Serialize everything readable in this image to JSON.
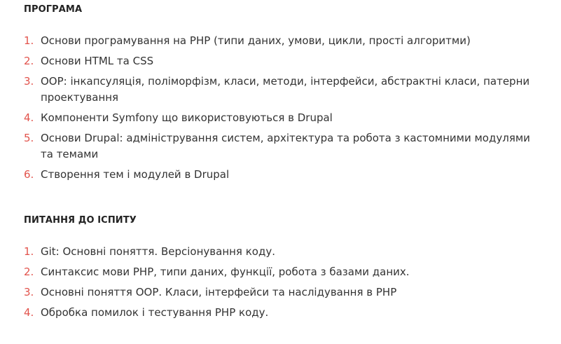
{
  "sections": [
    {
      "heading": "ПРОГРАМА",
      "items": [
        {
          "num": "1.",
          "text": "Основи програмування на PHP (типи даних, умови, цикли, прості алгоритми)"
        },
        {
          "num": "2.",
          "text": "Основи HTML та CSS"
        },
        {
          "num": "3.",
          "text": "ООР: інкапсуляція, поліморфізм, класи, методи, інтерфейси, абстрактні класи, патерни проектування"
        },
        {
          "num": "4.",
          "text": "Компоненти Symfony що використовуються в Drupal"
        },
        {
          "num": "5.",
          "text": "Основи Drupal: адміністрування систем, архітектура та робота з кастомними модулями та темами"
        },
        {
          "num": "6.",
          "text": "Створення тем і модулей в Drupal"
        }
      ]
    },
    {
      "heading": "ПИТАННЯ ДО ІСПИТУ",
      "items": [
        {
          "num": "1.",
          "text": "Git: Основні поняття. Версіонування коду."
        },
        {
          "num": "2.",
          "text": "Синтаксис мови PHP, типи даних, функції, робота з базами даних."
        },
        {
          "num": "3.",
          "text": "Основні поняття ООР. Класи, інтерфейси та наслідування в PHP"
        },
        {
          "num": "4.",
          "text": "Обробка помилок і тестування PHP коду."
        }
      ]
    }
  ],
  "colors": {
    "accent": "#e2534c",
    "text": "#333333",
    "heading": "#222222"
  }
}
